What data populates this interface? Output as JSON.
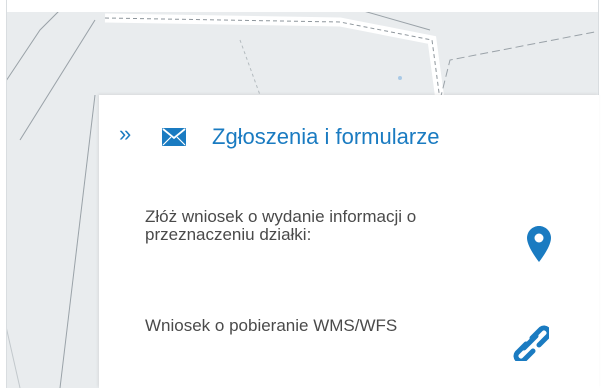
{
  "panel": {
    "title": "Zgłoszenia i formularze",
    "collapse_glyph": "»",
    "title_icon": "envelope-icon",
    "accent_color": "#1a7bc1",
    "items": [
      {
        "label": "Złóż wniosek o wydanie informacji o przeznaczeniu działki:",
        "icon": "map-pin-icon"
      },
      {
        "label": "Wniosek o pobieranie WMS/WFS",
        "icon": "link-icon"
      }
    ]
  },
  "map": {
    "background_color": "#e9ecee",
    "road_color": "#ffffff",
    "parcel_line_color": "#9aa2a8"
  }
}
